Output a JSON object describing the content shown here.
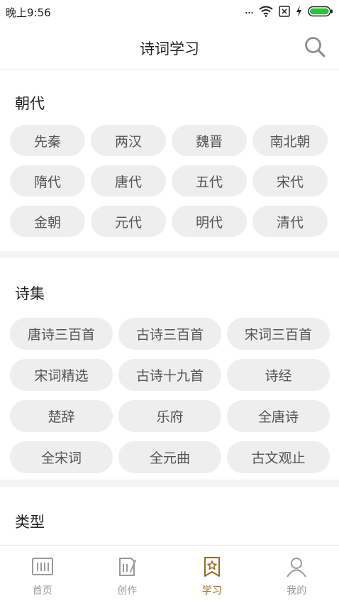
{
  "status_bar": {
    "time": "晚上9:56",
    "dots": "..."
  },
  "header": {
    "title": "诗词学习"
  },
  "dynasty": {
    "title": "朝代",
    "items": [
      "先秦",
      "两汉",
      "魏晋",
      "南北朝",
      "隋代",
      "唐代",
      "五代",
      "宋代",
      "金朝",
      "元代",
      "明代",
      "清代"
    ]
  },
  "collections": {
    "title": "诗集",
    "items": [
      "唐诗三百首",
      "古诗三百首",
      "宋词三百首",
      "宋词精选",
      "古诗十九首",
      "诗经",
      "楚辞",
      "乐府",
      "全唐诗",
      "全宋词",
      "全元曲",
      "古文观止"
    ]
  },
  "types": {
    "title": "类型"
  },
  "tabbar": {
    "active_color": "#9b6a2a",
    "items": [
      {
        "label": "首页",
        "icon": "home-icon"
      },
      {
        "label": "创作",
        "icon": "write-icon"
      },
      {
        "label": "学习",
        "icon": "study-icon"
      },
      {
        "label": "我的",
        "icon": "profile-icon"
      }
    ]
  }
}
